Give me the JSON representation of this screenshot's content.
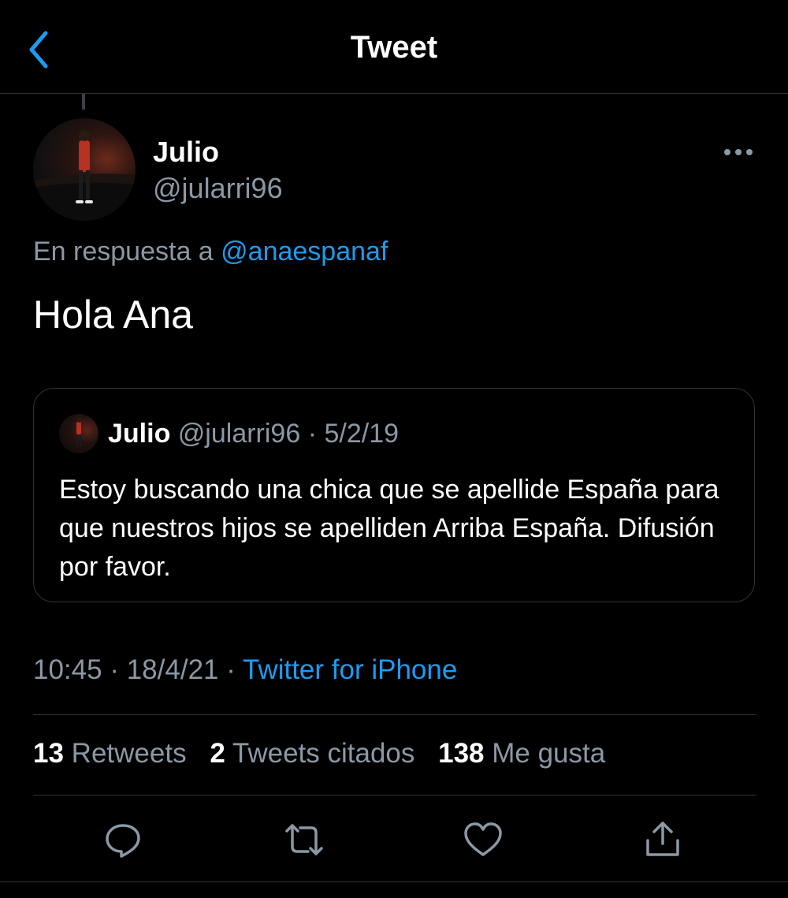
{
  "header": {
    "title": "Tweet",
    "back_icon": "chevron-left-icon"
  },
  "tweet": {
    "author_name": "Julio",
    "author_handle": "@jularri96",
    "reply_prefix": "En respuesta a",
    "reply_to": "@anaespanaf",
    "text": "Hola Ana",
    "more_icon": "ellipsis-icon"
  },
  "quote": {
    "author_name": "Julio",
    "author_handle": "@jularri96",
    "separator": "·",
    "date": "5/2/19",
    "text": "Estoy buscando una chica que se apellide España para que nuestros hijos se apelliden Arriba España. Difusión por favor."
  },
  "meta": {
    "time": "10:45",
    "separator": "·",
    "date": "18/4/21",
    "source": "Twitter for iPhone"
  },
  "stats": {
    "retweets_count": "13",
    "retweets_label": "Retweets",
    "quotes_count": "2",
    "quotes_label": "Tweets citados",
    "likes_count": "138",
    "likes_label": "Me gusta"
  },
  "actions": [
    "reply-icon",
    "retweet-icon",
    "like-icon",
    "share-icon"
  ],
  "colors": {
    "accent": "#1d9bf0",
    "background": "#000000",
    "muted": "#8b98a5",
    "border": "#2f3336"
  }
}
